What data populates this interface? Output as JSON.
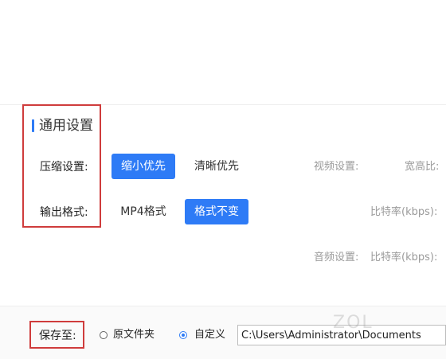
{
  "section": {
    "title": "通用设置"
  },
  "compression": {
    "label": "压缩设置:",
    "options": [
      {
        "label": "缩小优先",
        "selected": true
      },
      {
        "label": "清晰优先",
        "selected": false
      }
    ]
  },
  "output_format": {
    "label": "输出格式:",
    "options": [
      {
        "label": "MP4格式",
        "selected": false
      },
      {
        "label": "格式不变",
        "selected": true
      }
    ]
  },
  "video": {
    "label": "视频设置:",
    "aspect_label": "宽高比:",
    "bitrate_label": "比特率(kbps):"
  },
  "audio": {
    "label": "音频设置:",
    "bitrate_label": "比特率(kbps):"
  },
  "save": {
    "label": "保存至:",
    "options": [
      {
        "label": "原文件夹",
        "selected": false
      },
      {
        "label": "自定义",
        "selected": true
      }
    ],
    "path": "C:\\Users\\Administrator\\Documents"
  },
  "watermark": "ZOL",
  "colors": {
    "accent": "#2e7bf6",
    "annotation": "#cf3c3c",
    "muted_text": "#9a9a9a"
  }
}
